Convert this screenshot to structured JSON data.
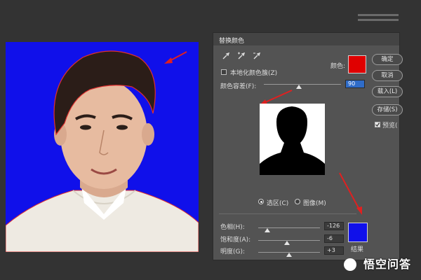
{
  "dialog": {
    "title": "替换颜色",
    "localized_color_clusters": "本地化颜色簇(Z)",
    "color_label": "颜色:",
    "fuzziness_label": "颜色容差(F):",
    "fuzziness_value": "90",
    "fuzziness_level": 0.45,
    "selection_radio": "选区(C)",
    "image_radio": "图像(M)",
    "selected_color": "#e00000",
    "hue_label": "色相(H):",
    "hue_value": "-126",
    "hue_level": 0.15,
    "saturation_label": "饱和度(A):",
    "saturation_value": "-6",
    "saturation_level": 0.47,
    "lightness_label": "明度(G):",
    "lightness_value": "+3",
    "lightness_level": 0.5,
    "result_label": "结果",
    "result_color": "#1010ea",
    "buttons": {
      "ok": "确定",
      "cancel": "取消",
      "load": "载入(L)",
      "save": "存储(S)"
    },
    "preview_label": "预览("
  },
  "canvas": {
    "background_color": "#1010ea"
  },
  "watermark": "悟空问答"
}
